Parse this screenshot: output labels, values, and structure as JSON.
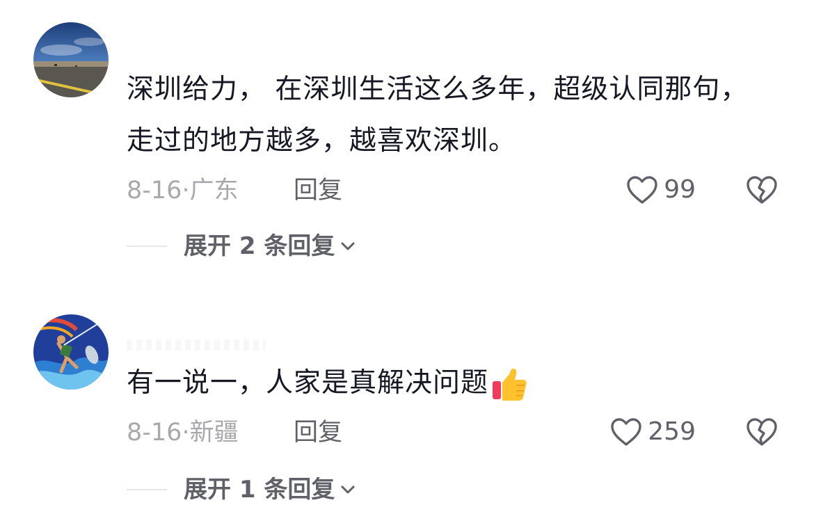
{
  "comments": [
    {
      "text": "深圳给力， 在深圳生活这么多年，超级认同那句，走过的地方越多，越喜欢深圳。",
      "date": "8-16",
      "separator": "·",
      "location": "广东",
      "reply_label": "回复",
      "likes": "99",
      "expand_label": "展开 2 条回复",
      "avatar_icon": "road-landscape-avatar"
    },
    {
      "text": "有一说一，人家是真解决问题",
      "emoji": "thumbs-up-icon",
      "date": "8-16",
      "separator": "·",
      "location": "新疆",
      "reply_label": "回复",
      "likes": "259",
      "expand_label": "展开 1 条回复",
      "avatar_icon": "fisherman-art-avatar"
    }
  ],
  "colors": {
    "text": "#161823",
    "meta": "#a8a8ad",
    "secondary": "#606068",
    "divider": "#e6e6e9"
  }
}
